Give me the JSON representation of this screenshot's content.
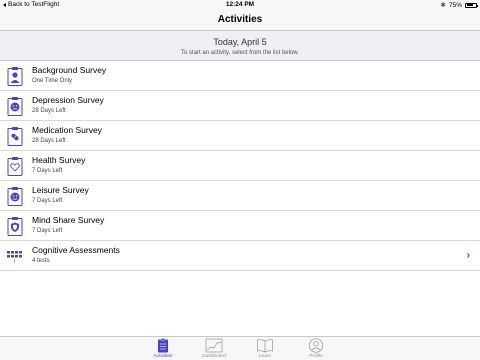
{
  "status_bar": {
    "back_label": "Back to TestFlight",
    "time": "12:24 PM",
    "battery": "75%",
    "battery_level": 0.75
  },
  "nav": {
    "title": "Activities"
  },
  "header": {
    "date": "Today, April 5",
    "instruction": "To start an activity, select from the list below."
  },
  "activities": [
    {
      "title": "Background Survey",
      "subtitle": "One Time Only",
      "icon": "person-clipboard-icon"
    },
    {
      "title": "Depression Survey",
      "subtitle": "28 Days Left",
      "icon": "sad-face-clipboard-icon"
    },
    {
      "title": "Medication Survey",
      "subtitle": "28 Days Left",
      "icon": "pill-clipboard-icon"
    },
    {
      "title": "Health Survey",
      "subtitle": "7 Days Left",
      "icon": "heart-clipboard-icon"
    },
    {
      "title": "Leisure Survey",
      "subtitle": "7 Days Left",
      "icon": "smile-face-clipboard-icon"
    },
    {
      "title": "Mind Share Survey",
      "subtitle": "7 Days Left",
      "icon": "shield-clipboard-icon"
    },
    {
      "title": "Cognitive Assessments",
      "subtitle": "4 tests",
      "icon": "cognitive-grid-icon"
    }
  ],
  "tabs": [
    {
      "label": "Activities",
      "icon": "clipboard-tab-icon",
      "active": true
    },
    {
      "label": "Dashboard",
      "icon": "chart-tab-icon",
      "active": false
    },
    {
      "label": "Learn",
      "icon": "book-tab-icon",
      "active": false
    },
    {
      "label": "Profile",
      "icon": "profile-tab-icon",
      "active": false
    }
  ],
  "colors": {
    "accent": "#4a43c4",
    "inactive": "#929292"
  }
}
